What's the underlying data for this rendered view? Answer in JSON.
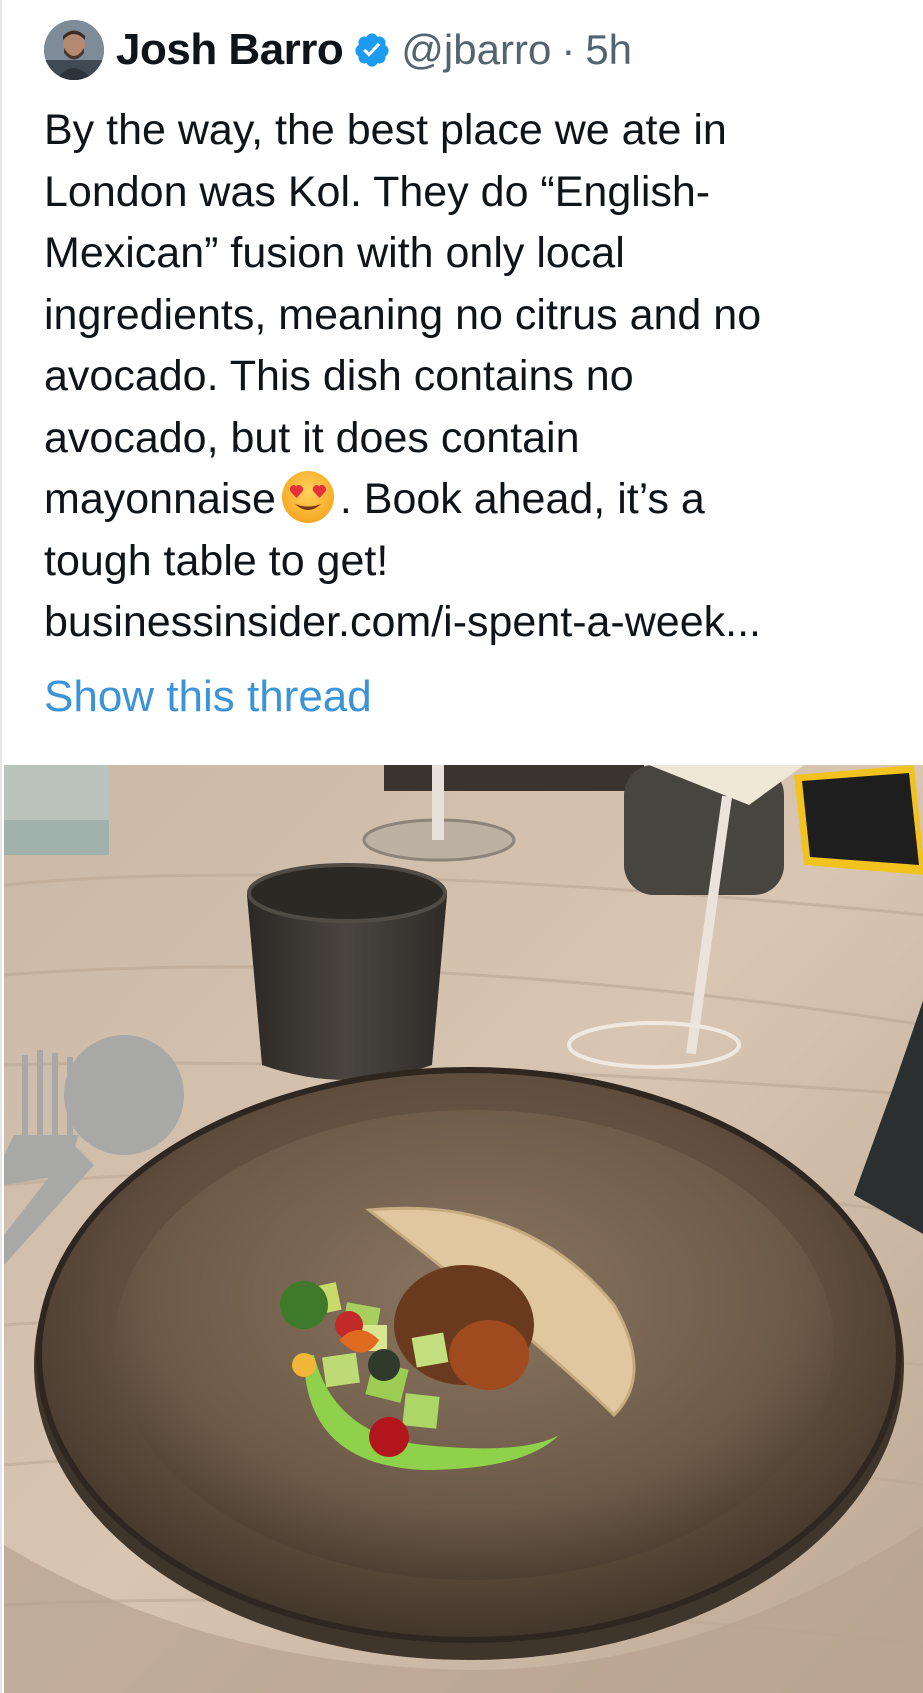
{
  "author": {
    "name": "Josh Barro",
    "handle": "@jbarro",
    "separator": "·",
    "time": "5h",
    "verified_icon": "verified-badge-icon",
    "badge_color": "#1d9bf0"
  },
  "tweet": {
    "text_before_emoji": "By the way, the best place we ate in\nLondon was Kol. They do “English-\nMexican” fusion with only local\ningredients, meaning no citrus and no\navocado. This dish contains no\navocado, but it does contain\nmayonnaise",
    "emoji": "heart-eyes-emoji",
    "text_after_emoji": ". Book ahead, it’s a\ntough table to get!",
    "link": "businessinsider.com/i-spent-a-week...",
    "show_thread": "Show this thread"
  },
  "colors": {
    "link": "#0f1419",
    "thread": "#3b94d9",
    "secondary": "#536471"
  },
  "photo": {
    "subject": "food-photo"
  }
}
